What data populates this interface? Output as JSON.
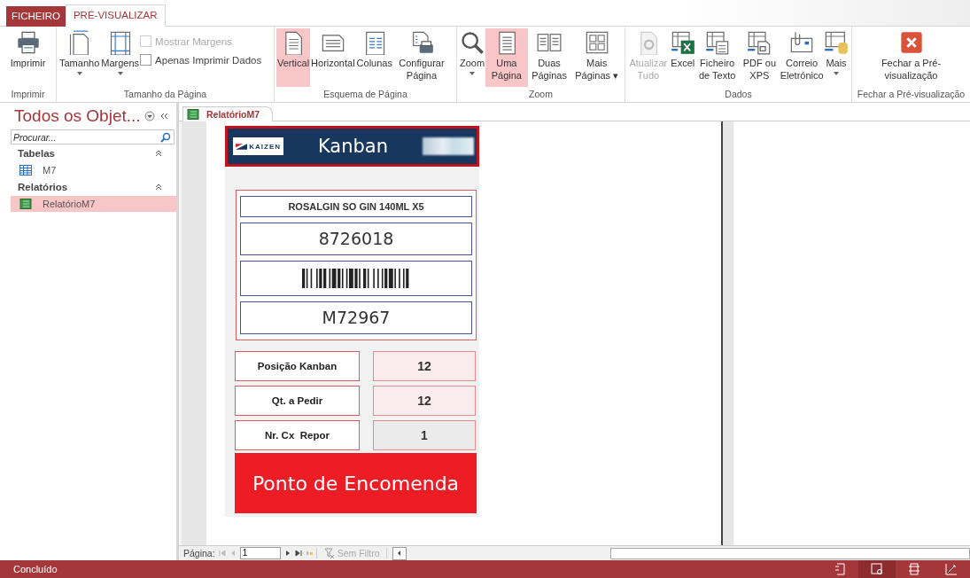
{
  "ribbon_tabs": [
    {
      "label": "FICHEIRO",
      "kind": "file",
      "selected": false
    },
    {
      "label": "PRÉ-VISUALIZAR",
      "kind": "tab",
      "selected": true
    }
  ],
  "ribbon_groups": [
    {
      "label": "Imprimir",
      "items": [
        {
          "kind": "large",
          "label": "Imprimir",
          "selected": false,
          "disabled": false
        }
      ]
    },
    {
      "label": "Tamanho da Página",
      "items": [
        {
          "kind": "large",
          "label": "Tamanho",
          "dropdown": true,
          "selected": false,
          "disabled": false
        },
        {
          "kind": "large",
          "label": "Margens",
          "dropdown": true,
          "selected": false,
          "disabled": false
        },
        {
          "kind": "checks",
          "checks": [
            {
              "label": "Mostrar Margens",
              "checked": false,
              "disabled": true
            },
            {
              "label": "Apenas Imprimir Dados",
              "checked": false,
              "disabled": false
            }
          ]
        }
      ]
    },
    {
      "label": "Esquema de Página",
      "items": [
        {
          "kind": "large",
          "label": "Vertical",
          "selected": true,
          "disabled": false
        },
        {
          "kind": "large",
          "label": "Horizontal",
          "selected": false,
          "disabled": false
        },
        {
          "kind": "large",
          "label": "Colunas",
          "selected": false,
          "disabled": false
        },
        {
          "kind": "large",
          "label": "Configurar Página",
          "selected": false,
          "disabled": false
        }
      ]
    },
    {
      "label": "Zoom",
      "items": [
        {
          "kind": "large",
          "label": "Zoom",
          "dropdown": true,
          "selected": false,
          "disabled": false
        },
        {
          "kind": "large",
          "label": "Uma Página",
          "selected": true,
          "disabled": false
        },
        {
          "kind": "large",
          "label": "Duas Páginas",
          "selected": false,
          "disabled": false
        },
        {
          "kind": "large",
          "label": "Mais Páginas ▾",
          "selected": false,
          "disabled": false
        }
      ]
    },
    {
      "label": "Dados",
      "items": [
        {
          "kind": "large",
          "label": "Atualizar Tudo",
          "selected": false,
          "disabled": true
        },
        {
          "kind": "large",
          "label": "Excel",
          "selected": false,
          "disabled": false
        },
        {
          "kind": "large",
          "label": "Ficheiro de Texto",
          "selected": false,
          "disabled": false
        },
        {
          "kind": "large",
          "label": "PDF ou XPS",
          "selected": false,
          "disabled": false
        },
        {
          "kind": "large",
          "label": "Correio Eletrónico",
          "selected": false,
          "disabled": false
        },
        {
          "kind": "large",
          "label": "Mais",
          "dropdown": true,
          "selected": false,
          "disabled": false
        }
      ]
    },
    {
      "label": "Fechar a Pré-visualização",
      "items": [
        {
          "kind": "large",
          "label": "Fechar a Pré-visualização",
          "selected": false,
          "disabled": false
        }
      ]
    }
  ],
  "nav_pane": {
    "title": "Todos os Objet...",
    "search": {
      "placeholder": "Procurar..."
    },
    "groups": [
      {
        "label": "Tabelas",
        "expanded": true,
        "items": [
          {
            "label": "M7",
            "kind": "table",
            "selected": false
          }
        ]
      },
      {
        "label": "Relatórios",
        "expanded": true,
        "items": [
          {
            "label": "RelatórioM7",
            "kind": "report",
            "selected": true
          }
        ]
      }
    ]
  },
  "document_tab": {
    "label": "RelatórioM7"
  },
  "report": {
    "header": {
      "logo_text": "KAIZEN",
      "title": "Kanban"
    },
    "product": {
      "name": "ROSALGIN SO GIN 140ML X5",
      "code": "8726018",
      "reference": "M72967"
    },
    "fields": [
      {
        "label": "Posição Kanban",
        "value": "12",
        "color": "#faecec"
      },
      {
        "label": "Qt. a Pedir",
        "value": "12",
        "color": "#faecec"
      },
      {
        "label": "Nr. Cx  Repor",
        "value": "1",
        "color": "#ebebeb"
      }
    ],
    "banner": "Ponto de Encomenda"
  },
  "record_nav": {
    "label": "Página:",
    "page": "1",
    "filter": "Sem Filtro"
  },
  "status_bar": {
    "text": "Concluído"
  }
}
